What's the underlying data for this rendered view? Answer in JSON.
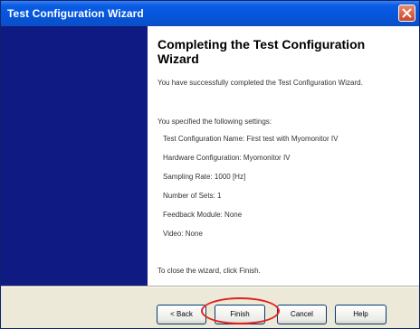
{
  "window": {
    "title": "Test Configuration Wizard"
  },
  "content": {
    "heading": "Completing the Test Configuration Wizard",
    "intro": "You have successfully completed the Test Configuration Wizard.",
    "settings_label": "You specified the following settings:",
    "settings": [
      "Test Configuration Name: First test with Myomonitor IV",
      "Hardware Configuration: Myomonitor IV",
      "Sampling Rate: 1000 [Hz]",
      "Number of Sets: 1",
      "Feedback Module: None",
      "Video: None"
    ],
    "closing": "To close the wizard, click Finish."
  },
  "buttons": {
    "back": "< Back",
    "finish": "Finish",
    "cancel": "Cancel",
    "help": "Help"
  },
  "colors": {
    "title_bar": "#0556dc",
    "sidebar": "#0f1a83",
    "highlight": "#e02020"
  }
}
